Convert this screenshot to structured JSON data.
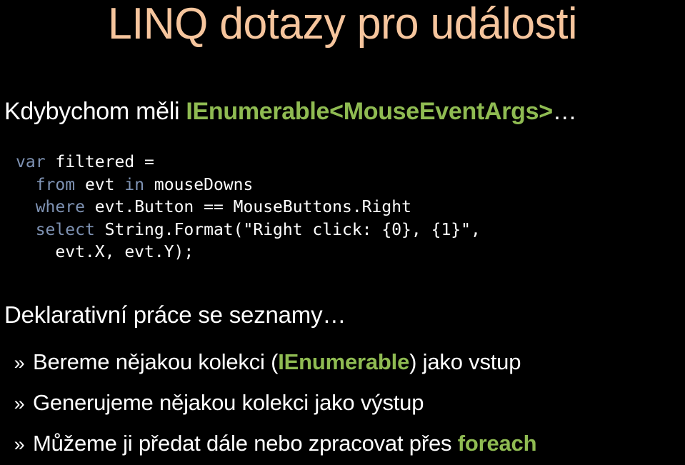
{
  "slide": {
    "background_color": "#000000",
    "title": "LINQ dotazy pro události",
    "title_color": "#f6c59d",
    "accent_green": "#8fbb52",
    "keyword_blue": "#7f93b4",
    "text_color": "#ffffff"
  },
  "subtitle": {
    "lead": "Kdybychom měli ",
    "code_term": "IEnumerable<MouseEventArgs>",
    "trailing": "…"
  },
  "code": {
    "lines": [
      [
        {
          "t": "var",
          "c": "kw"
        },
        {
          "t": " filtered =",
          "c": "plain"
        }
      ],
      [
        {
          "t": "  ",
          "c": "plain"
        },
        {
          "t": "from",
          "c": "kw"
        },
        {
          "t": " evt ",
          "c": "plain"
        },
        {
          "t": "in",
          "c": "kw"
        },
        {
          "t": " mouseDowns",
          "c": "plain"
        }
      ],
      [
        {
          "t": "  ",
          "c": "plain"
        },
        {
          "t": "where",
          "c": "kw"
        },
        {
          "t": " evt.Button == MouseButtons.Right",
          "c": "plain"
        }
      ],
      [
        {
          "t": "  ",
          "c": "plain"
        },
        {
          "t": "select",
          "c": "kw"
        },
        {
          "t": " String.Format(\"Right click: {0}, {1}\",",
          "c": "plain"
        }
      ],
      [
        {
          "t": "    evt.X, evt.Y);",
          "c": "plain"
        }
      ]
    ]
  },
  "body": {
    "line": "Deklarativní práce se seznamy…"
  },
  "bullets": {
    "marker": "»",
    "items": [
      {
        "pre": "Bereme nějakou kolekci (",
        "code_term": "IEnumerable",
        "post": ") jako vstup"
      },
      {
        "pre": "Generujeme nějakou kolekci jako výstup",
        "code_term": "",
        "post": ""
      },
      {
        "pre": "Můžeme ji předat dále nebo zpracovat přes ",
        "code_term": "foreach",
        "post": ""
      }
    ]
  }
}
